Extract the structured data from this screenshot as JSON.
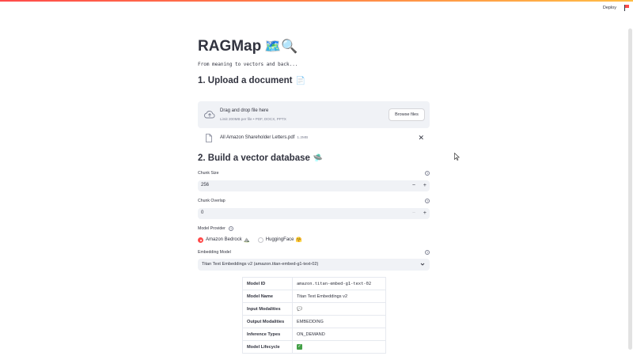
{
  "header": {
    "deploy_label": "Deploy",
    "menu_icon": "flag-icon"
  },
  "app": {
    "title": "RAGMap",
    "title_emoji": "🗺️🔍",
    "subtitle": "From meaning to vectors and back..."
  },
  "upload": {
    "heading": "1. Upload a document",
    "heading_emoji": "📄",
    "drop_title": "Drag and drop file here",
    "drop_limit": "Limit 200MB per file • PDF, DOCX, PPTX",
    "browse_label": "Browse files",
    "file_name": "All Amazon Shareholder Letters.pdf",
    "file_size": "1.2MB",
    "close_glyph": "✕",
    "cloud_icon": "cloud-upload-icon",
    "file_icon": "document-icon"
  },
  "vector_db": {
    "heading": "2. Build a vector database",
    "heading_emoji": "🛸",
    "chunk_size_label": "Chunk Size",
    "chunk_size_value": "256",
    "chunk_overlap_label": "Chunk Overlap",
    "chunk_overlap_value": "0",
    "minus_glyph": "−",
    "plus_glyph": "+",
    "help_glyph": "?",
    "model_provider_label": "Model Provider",
    "providers": [
      {
        "label": "Amazon Bedrock",
        "emoji": "⛰️",
        "selected": true
      },
      {
        "label": "HuggingFace",
        "emoji": "🤗",
        "selected": false
      }
    ],
    "embedding_model_label": "Embedding Model",
    "embedding_model_value": "Titan Text Embeddings v2 (amazon.titan-embed-g1-text-02)"
  },
  "model_table": {
    "rows": [
      {
        "key": "Model ID",
        "value": "amazon.titan-embed-g1-text-02"
      },
      {
        "key": "Model Name",
        "value": "Titan Text Embeddings v2"
      },
      {
        "key": "Input Modalities",
        "value": "💬"
      },
      {
        "key": "Output Modalities",
        "value": "EMBEDDING"
      },
      {
        "key": "Inference Types",
        "value": "ON_DEMAND"
      },
      {
        "key": "Model Lifecycle",
        "value": "✓"
      }
    ]
  },
  "colors": {
    "accent": "#ff4b4b",
    "input_bg": "#f0f2f6",
    "text": "#31333f",
    "muted": "#808495",
    "check_green": "#43a047"
  }
}
